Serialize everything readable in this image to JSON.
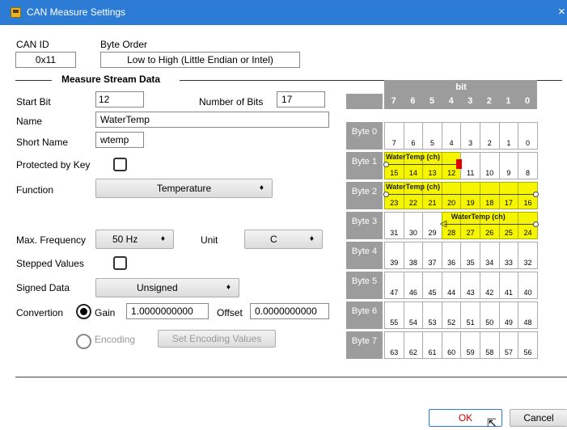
{
  "window": {
    "title": "CAN Measure Settings",
    "close_glyph": "×"
  },
  "header": {
    "can_id_label": "CAN ID",
    "can_id_value": "0x11",
    "byte_order_label": "Byte Order",
    "byte_order_value": "Low to High (Little Endian or Intel)"
  },
  "section": {
    "title": "Measure Stream Data"
  },
  "form": {
    "start_bit_label": "Start Bit",
    "start_bit_value": "12",
    "num_bits_label": "Number of Bits",
    "num_bits_value": "17",
    "name_label": "Name",
    "name_value": "WaterTemp",
    "short_name_label": "Short Name",
    "short_name_value": "wtemp",
    "protected_label": "Protected by Key",
    "protected_checked": false,
    "function_label": "Function",
    "function_value": "Temperature",
    "max_freq_label": "Max. Frequency",
    "max_freq_value": "50 Hz",
    "unit_label": "Unit",
    "unit_value": "C",
    "stepped_label": "Stepped Values",
    "stepped_checked": false,
    "signed_label": "Signed Data",
    "signed_value": "Unsigned",
    "conversion_label": "Convertion",
    "gain_label": "Gain",
    "gain_value": "1.0000000000",
    "offset_label": "Offset",
    "offset_value": "0.0000000000",
    "encoding_label": "Encoding",
    "set_encoding_label": "Set Encoding Values",
    "conversion_selected": "Gain"
  },
  "grid": {
    "bit_header": "bit",
    "col_headers": [
      "7",
      "6",
      "5",
      "4",
      "3",
      "2",
      "1",
      "0"
    ],
    "signal_label": "WaterTemp (ch)",
    "rows": [
      {
        "label": "Byte 0",
        "bits": [
          "7",
          "6",
          "5",
          "4",
          "3",
          "2",
          "1",
          "0"
        ]
      },
      {
        "label": "Byte 1",
        "bits": [
          "15",
          "14",
          "13",
          "12",
          "11",
          "10",
          "9",
          "8"
        ]
      },
      {
        "label": "Byte 2",
        "bits": [
          "23",
          "22",
          "21",
          "20",
          "19",
          "18",
          "17",
          "16"
        ]
      },
      {
        "label": "Byte 3",
        "bits": [
          "31",
          "30",
          "29",
          "28",
          "27",
          "26",
          "25",
          "24"
        ]
      },
      {
        "label": "Byte 4",
        "bits": [
          "39",
          "38",
          "37",
          "36",
          "35",
          "34",
          "33",
          "32"
        ]
      },
      {
        "label": "Byte 5",
        "bits": [
          "47",
          "46",
          "45",
          "44",
          "43",
          "42",
          "41",
          "40"
        ]
      },
      {
        "label": "Byte 6",
        "bits": [
          "55",
          "54",
          "53",
          "52",
          "51",
          "50",
          "49",
          "48"
        ]
      },
      {
        "label": "Byte 7",
        "bits": [
          "63",
          "62",
          "61",
          "60",
          "59",
          "58",
          "57",
          "56"
        ]
      }
    ],
    "highlight_color": "#f5f500",
    "marker_color": "#e00000"
  },
  "footer": {
    "ok_label": "OK",
    "cancel_label": "Cancel"
  }
}
